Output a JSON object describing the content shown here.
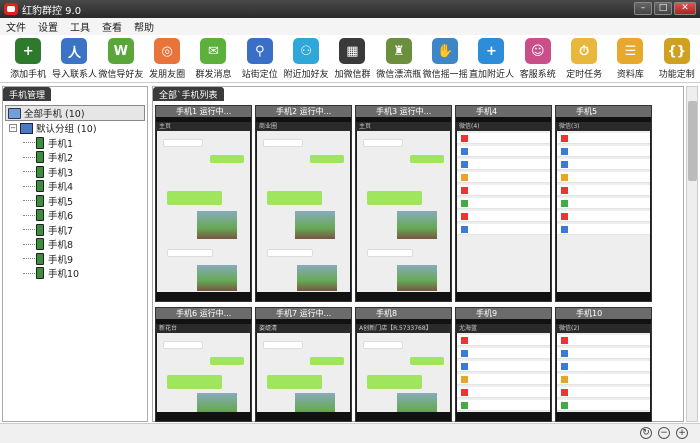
{
  "window": {
    "title": "红豹群控 9.0"
  },
  "menu": [
    "文件",
    "设置",
    "工具",
    "查看",
    "帮助"
  ],
  "toolbar": [
    {
      "label": "添加手机",
      "icon": "add-phone-icon",
      "color": "#2d7a2d"
    },
    {
      "label": "导入联系人",
      "icon": "contacts-icon",
      "color": "#3b74c4"
    },
    {
      "label": "微信导好友",
      "icon": "wechat-import-icon",
      "color": "#5aa63b"
    },
    {
      "label": "发朋友圈",
      "icon": "moments-icon",
      "color": "#e8743b"
    },
    {
      "label": "群发消息",
      "icon": "broadcast-icon",
      "color": "#5bb13c"
    },
    {
      "label": "站街定位",
      "icon": "pin-icon",
      "color": "#3a6fc7"
    },
    {
      "label": "附近加好友",
      "icon": "nearby-icon",
      "color": "#2fa7d8"
    },
    {
      "label": "加微信群",
      "icon": "qr-icon",
      "color": "#3a3a3a"
    },
    {
      "label": "微信漂流瓶",
      "icon": "bottle-icon",
      "color": "#6b8f3c"
    },
    {
      "label": "微信摇一摇",
      "icon": "shake-icon",
      "color": "#3f86c7"
    },
    {
      "label": "直加附近人",
      "icon": "add-nearby-icon",
      "color": "#2e8dd8"
    },
    {
      "label": "客服系统",
      "icon": "service-icon",
      "color": "#c94e8a"
    },
    {
      "label": "定时任务",
      "icon": "timer-icon",
      "color": "#e8b73b"
    },
    {
      "label": "资料库",
      "icon": "database-icon",
      "color": "#e8a82b"
    },
    {
      "label": "功能定制",
      "icon": "custom-icon",
      "color": "#d0a020"
    }
  ],
  "left_panel": {
    "tab": "手机管理",
    "root": "全部手机 (10)",
    "group": "默认分组 (10)",
    "phones": [
      "手机1",
      "手机2",
      "手机3",
      "手机4",
      "手机5",
      "手机6",
      "手机7",
      "手机8",
      "手机9",
      "手机10"
    ]
  },
  "right_panel": {
    "tab": "全部`手机列表"
  },
  "phones": [
    {
      "title": "手机1 运行中...",
      "nav": "主页"
    },
    {
      "title": "手机2 运行中...",
      "nav": "商业圈"
    },
    {
      "title": "手机3 运行中...",
      "nav": "主页"
    },
    {
      "title": "手机4",
      "nav": "微信(4)"
    },
    {
      "title": "手机5",
      "nav": "微信(3)"
    },
    {
      "title": "手机6 运行中...",
      "nav": "新花台"
    },
    {
      "title": "手机7 运行中...",
      "nav": "姿缇清"
    },
    {
      "title": "手机8",
      "nav": "A创新门店【R.5733768】"
    },
    {
      "title": "手机9",
      "nav": "尤海蓝"
    },
    {
      "title": "手机10",
      "nav": "微信(2)"
    }
  ]
}
